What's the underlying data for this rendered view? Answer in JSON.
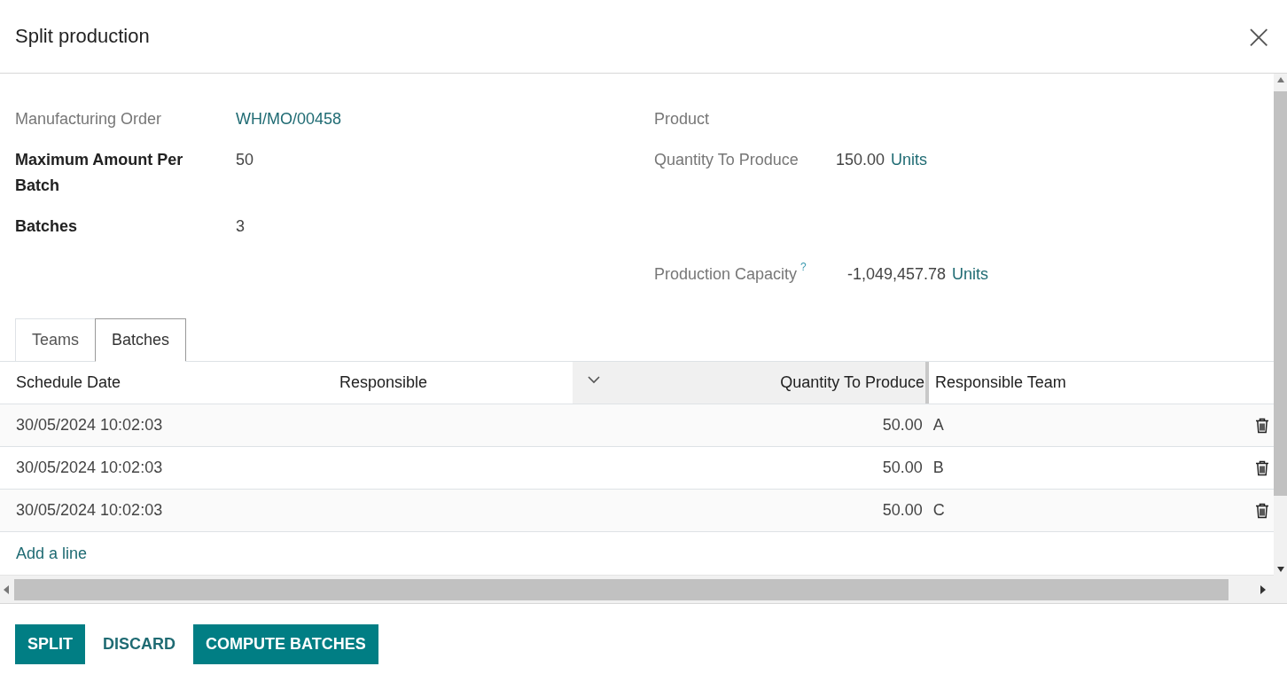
{
  "dialog": {
    "title": "Split production",
    "close": "×"
  },
  "fields_left": [
    {
      "label": "Manufacturing Order",
      "readonly": true,
      "value": "WH/MO/00458",
      "kind": "link"
    },
    {
      "label": "Maximum Amount Per Batch",
      "readonly": false,
      "value": "50",
      "kind": "plain"
    },
    {
      "label": "Batches",
      "readonly": false,
      "value": "3",
      "kind": "plain"
    }
  ],
  "fields_right": [
    {
      "label": "Product",
      "readonly": true,
      "kind": "empty"
    },
    {
      "label": "Quantity To Produce",
      "readonly": true,
      "value": "150.00",
      "unit": "Units",
      "kind": "quantity"
    },
    {
      "label": "Production Capacity",
      "help": "?",
      "readonly": true,
      "value": "-1,049,457.78",
      "unit": "Units",
      "kind": "quantity"
    }
  ],
  "tabs": [
    {
      "label": "Teams",
      "selected": false
    },
    {
      "label": "Batches",
      "selected": true
    }
  ],
  "table": {
    "columns": [
      {
        "label": "Schedule Date",
        "highlighted": false
      },
      {
        "label": "Responsible",
        "highlighted": false
      },
      {
        "label": "Quantity To Produce",
        "highlighted": true
      },
      {
        "label": "Responsible Team",
        "highlighted": false
      }
    ],
    "rows": [
      {
        "schedule_date": "30/05/2024 10:02:03",
        "quantity": "50.00",
        "team": "A"
      },
      {
        "schedule_date": "30/05/2024 10:02:03",
        "quantity": "50.00",
        "team": "B"
      },
      {
        "schedule_date": "30/05/2024 10:02:03",
        "quantity": "50.00",
        "team": "C"
      }
    ],
    "add_line": "Add a line"
  },
  "buttons": [
    {
      "label": "SPLIT",
      "kind": "primary"
    },
    {
      "label": "DISCARD",
      "kind": "secondary"
    },
    {
      "label": "COMPUTE BATCHES",
      "kind": "primary"
    }
  ]
}
